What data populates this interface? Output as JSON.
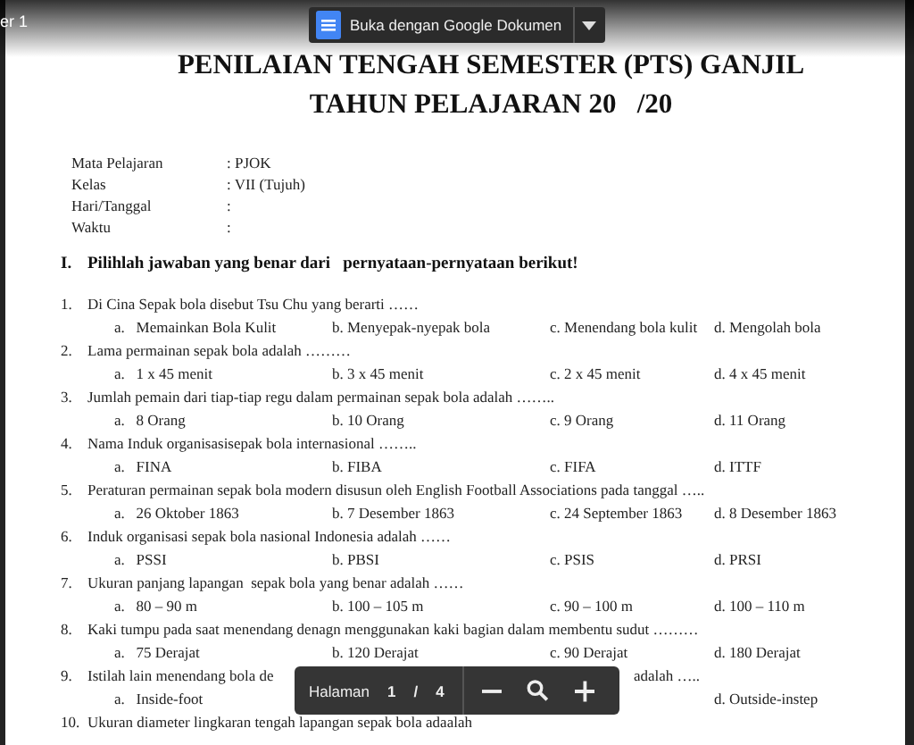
{
  "viewer": {
    "file_name": "er 1",
    "open_button": "Buka dengan Google Dokumen"
  },
  "document": {
    "title": [
      "PENILAIAN TENGAH SEMESTER (PTS) GANJIL",
      "TAHUN PELAJARAN 20   /20"
    ],
    "info": [
      {
        "label": "Mata Pelajaran",
        "value": ": PJOK"
      },
      {
        "label": "Kelas",
        "value": ": VII (Tujuh)"
      },
      {
        "label": "Hari/Tanggal",
        "value": ":"
      },
      {
        "label": "Waktu",
        "value": ":"
      }
    ],
    "section": {
      "number": "I.",
      "heading": "Pilihlah jawaban yang benar dari   pernyataan-pernyataan berikut!"
    },
    "questions": [
      {
        "number": "1.",
        "text": "Di Cina Sepak bola disebut Tsu Chu yang berarti ……",
        "options": [
          "a.   Memainkan Bola Kulit",
          "b. Menyepak-nyepak bola",
          "c. Menendang bola kulit",
          "d. Mengolah bola"
        ]
      },
      {
        "number": "2.",
        "text": "Lama permainan sepak bola adalah ………",
        "options": [
          "a.   1 x 45 menit",
          "b. 3 x 45 menit",
          "c. 2 x 45 menit",
          "d. 4 x 45 menit"
        ]
      },
      {
        "number": "3.",
        "text": "Jumlah pemain dari tiap-tiap regu dalam permainan sepak bola adalah ……..",
        "options": [
          "a.   8 Orang",
          "b. 10 Orang",
          "c. 9 Orang",
          "d. 11 Orang"
        ]
      },
      {
        "number": "4.",
        "text": "Nama Induk organisasisepak bola internasional ……..",
        "options": [
          "a.   FINA",
          "b. FIBA",
          "c. FIFA",
          "d. ITTF"
        ]
      },
      {
        "number": "5.",
        "text": "Peraturan permainan sepak bola modern disusun oleh English Football Associations pada tanggal …..",
        "options": [
          "a.   26 Oktober 1863",
          "b. 7 Desember 1863",
          "c. 24 September 1863",
          "d. 8 Desember 1863"
        ]
      },
      {
        "number": "6.",
        "text": "Induk organisasi sepak bola nasional Indonesia adalah ……",
        "options": [
          "a.   PSSI",
          "b. PBSI",
          "c. PSIS",
          "d. PRSI"
        ]
      },
      {
        "number": "7.",
        "text": "Ukuran panjang lapangan  sepak bola yang benar adalah ……",
        "options": [
          "a.   80 – 90 m",
          "b. 100 – 105 m",
          "c. 90 – 100 m",
          "d. 100 – 110 m"
        ]
      },
      {
        "number": "8.",
        "text": "Kaki tumpu pada saat menendang denagn menggunakan kaki bagian dalam membentu sudut ………",
        "options": [
          "a.   75 Derajat",
          "b. 120 Derajat",
          "c. 90 Derajat",
          "d. 180 Derajat"
        ]
      },
      {
        "number": "9.",
        "text": "Istilah lain menendang bola de",
        "text_end": "adalah …..",
        "options": [
          "a.   Inside-foot",
          "d. Outside-instep"
        ]
      },
      {
        "number": "10.",
        "text": "Ukuran diameter lingkaran tengah lapangan sepak bola adaalah"
      }
    ]
  },
  "pager": {
    "label": "Halaman",
    "current": "1",
    "separator": "/",
    "total": "4"
  }
}
